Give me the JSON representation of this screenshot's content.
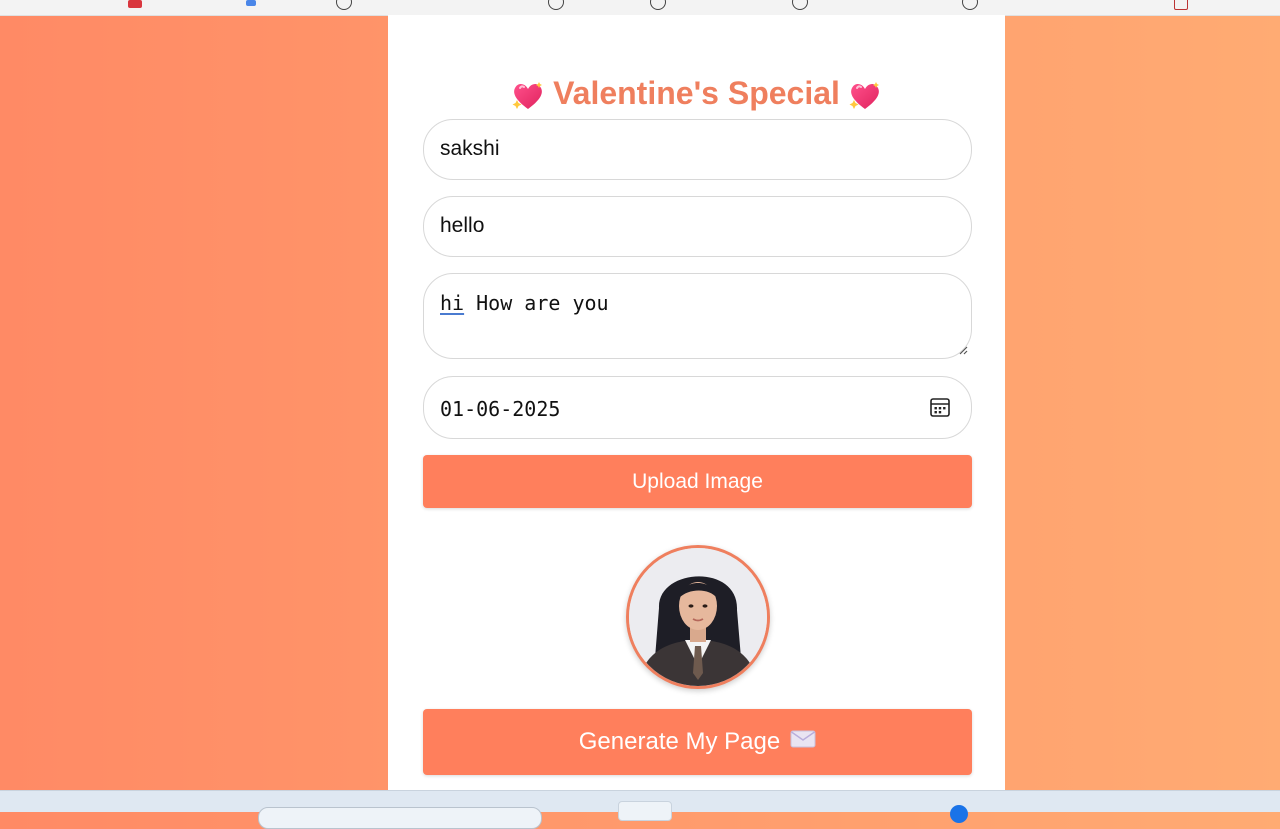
{
  "page": {
    "title": "Valentine's Special",
    "title_icon": "heart-sparkle-icon"
  },
  "form": {
    "name_value": "sakshi",
    "subject_value": "hello",
    "message_first_word": "hi",
    "message_rest": " How are you",
    "date_value": "01-06-2025",
    "date_icon": "calendar-icon"
  },
  "buttons": {
    "upload_label": "Upload Image",
    "generate_label": "Generate My Page",
    "generate_icon": "envelope-icon"
  },
  "colors": {
    "accent": "#ff7f5c",
    "title": "#ef7f5e",
    "background_left": "#ff8a65",
    "background_right": "#ffab73"
  }
}
